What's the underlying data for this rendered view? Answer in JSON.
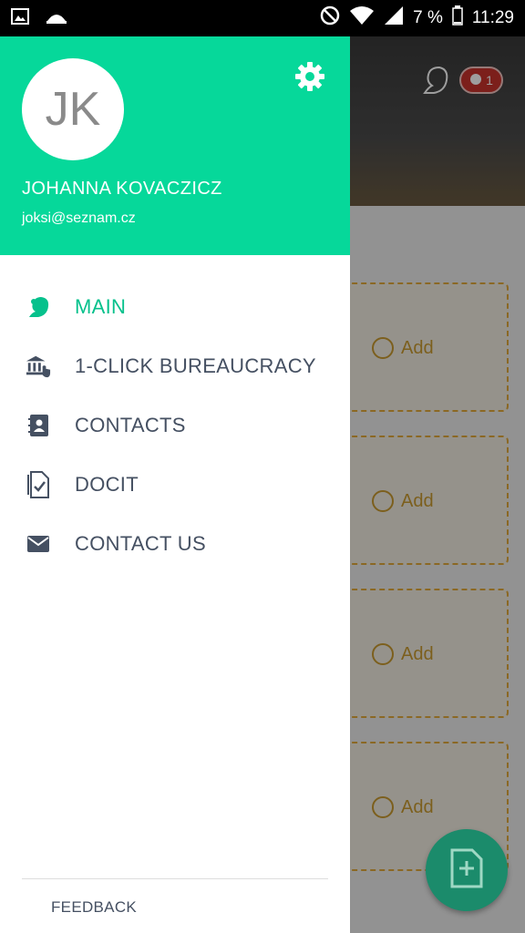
{
  "status_bar": {
    "battery": "7 %",
    "time": "11:29",
    "icons": [
      "image-icon",
      "dome-icon",
      "do-not-disturb-icon",
      "wifi-icon",
      "signal-icon",
      "battery-icon"
    ]
  },
  "background": {
    "badge_count": "1",
    "cards": [
      {
        "label": "Add"
      },
      {
        "label": "Add"
      },
      {
        "label": "Add"
      },
      {
        "label": "Add"
      }
    ]
  },
  "drawer": {
    "avatar_initials": "JK",
    "user_name": "JOHANNA KOVACZICZ",
    "user_email": "joksi@seznam.cz",
    "menu": [
      {
        "label": "MAIN",
        "icon": "squirrel-icon",
        "active": true
      },
      {
        "label": "1-CLICK BUREAUCRACY",
        "icon": "bank-click-icon",
        "active": false
      },
      {
        "label": "CONTACTS",
        "icon": "contacts-book-icon",
        "active": false
      },
      {
        "label": "DOCIT",
        "icon": "document-check-icon",
        "active": false
      },
      {
        "label": "CONTACT US",
        "icon": "envelope-icon",
        "active": false
      }
    ],
    "feedback_label": "FEEDBACK"
  },
  "colors": {
    "accent": "#06d89a",
    "active_text": "#06c18c",
    "menu_text": "#455062",
    "badge": "#c9322d",
    "fab": "#1b8b6b"
  }
}
